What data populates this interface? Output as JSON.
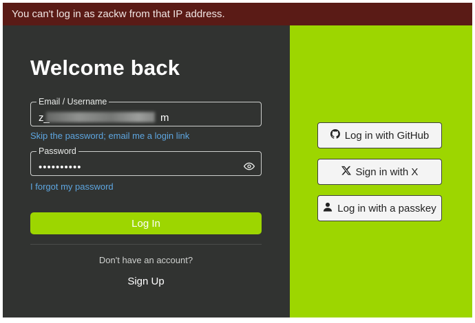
{
  "error_banner": {
    "message": "You can't log in as zackw from that IP address."
  },
  "login": {
    "title": "Welcome back",
    "email_label": "Email / Username",
    "email_visible_start": "z_",
    "email_visible_end": "m",
    "magic_link": "Skip the password; email me a login link",
    "password_label": "Password",
    "password_value": "••••••••••",
    "forgot_link": "I forgot my password",
    "login_button": "Log In",
    "no_account_text": "Don't have an account?",
    "signup_link": "Sign Up"
  },
  "alternatives": {
    "github": "Log in with GitHub",
    "x": "Sign in with X",
    "passkey": "Log in with a passkey"
  },
  "colors": {
    "accent": "#9dd600",
    "error_bg": "#5a1b16",
    "panel_bg": "#313331",
    "link": "#5ea6e0"
  }
}
